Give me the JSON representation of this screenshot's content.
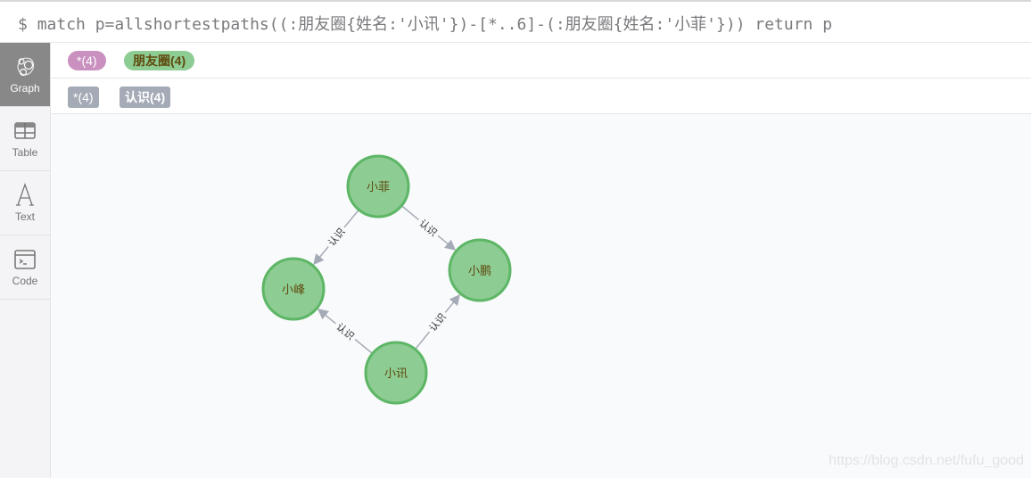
{
  "query": {
    "prompt": "$",
    "text": "match p=allshortestpaths((:朋友圈{姓名:'小讯'})-[*..6]-(:朋友圈{姓名:'小菲'})) return p"
  },
  "sidebar": {
    "items": [
      {
        "label": "Graph",
        "icon": "graph-icon",
        "active": true
      },
      {
        "label": "Table",
        "icon": "table-icon"
      },
      {
        "label": "Text",
        "icon": "text-icon"
      },
      {
        "label": "Code",
        "icon": "code-icon"
      }
    ]
  },
  "legend": {
    "node_labels": [
      {
        "label": "*(4)",
        "color": "#c990c0",
        "text_color": "#ffffff"
      },
      {
        "label": "朋友圈(4)",
        "color": "#8dcc93",
        "text_color": "#604a0e"
      }
    ],
    "relationship_types": [
      {
        "label": "*(4)",
        "color": "#a5abb6"
      },
      {
        "label": "认识(4)",
        "color": "#a5abb6"
      }
    ]
  },
  "graph": {
    "node_fill": "#8dcc93",
    "node_stroke": "#5db665",
    "node_text_color": "#604a0e",
    "edge_color": "#a5abb6",
    "nodes": [
      {
        "id": "fei",
        "name": "小菲"
      },
      {
        "id": "feng",
        "name": "小峰"
      },
      {
        "id": "peng",
        "name": "小鹏"
      },
      {
        "id": "xun",
        "name": "小讯"
      }
    ],
    "edges": [
      {
        "from": "fei",
        "to": "feng",
        "type": "认识"
      },
      {
        "from": "fei",
        "to": "peng",
        "type": "认识"
      },
      {
        "from": "xun",
        "to": "feng",
        "type": "认识"
      },
      {
        "from": "xun",
        "to": "peng",
        "type": "认识"
      }
    ]
  },
  "watermark": "https://blog.csdn.net/fufu_good"
}
